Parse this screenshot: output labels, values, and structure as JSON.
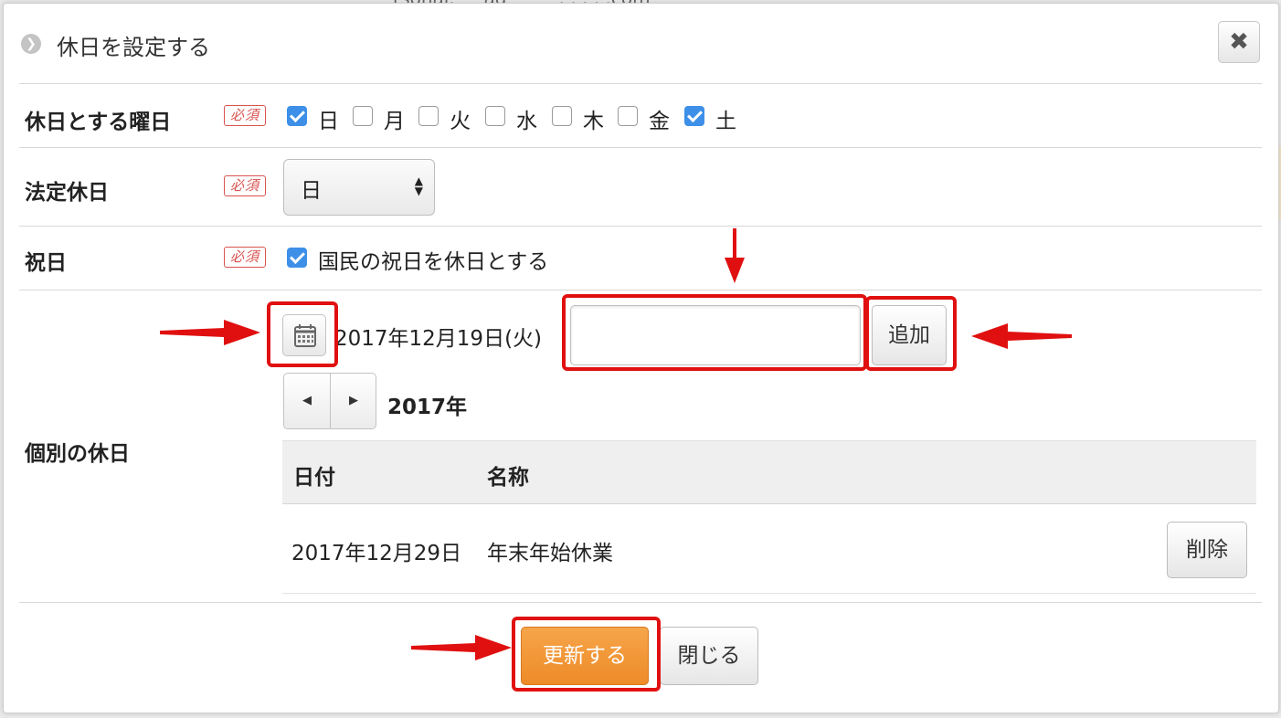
{
  "background": {
    "partial_text": "rsonal.· · ·ad · · · · . . . . .com"
  },
  "dialog": {
    "title": "休日を設定する",
    "close_label": "✖"
  },
  "required_badge": "必須",
  "weekdays": {
    "label": "休日とする曜日",
    "days": [
      {
        "label": "日",
        "checked": true
      },
      {
        "label": "月",
        "checked": false
      },
      {
        "label": "火",
        "checked": false
      },
      {
        "label": "水",
        "checked": false
      },
      {
        "label": "木",
        "checked": false
      },
      {
        "label": "金",
        "checked": false
      },
      {
        "label": "土",
        "checked": true
      }
    ]
  },
  "legal_holiday": {
    "label": "法定休日",
    "selected": "日"
  },
  "national_holiday": {
    "label": "祝日",
    "checkbox_label": "国民の祝日を休日とする",
    "checked": true
  },
  "custom_holidays": {
    "label": "個別の休日",
    "selected_date": "2017年12月19日(火)",
    "name_input": {
      "value": "",
      "placeholder": ""
    },
    "add_label": "追加",
    "year_label": "2017年",
    "table": {
      "headers": [
        "日付",
        "名称"
      ],
      "rows": [
        {
          "date": "2017年12月29日",
          "name": "年末年始休業",
          "delete_label": "削除"
        }
      ]
    }
  },
  "footer": {
    "update_label": "更新する",
    "close_label": "閉じる"
  },
  "colors": {
    "accent": "#ee8b28",
    "check": "#3d8fe8",
    "required": "#d9534f",
    "highlight": "#e01010"
  }
}
